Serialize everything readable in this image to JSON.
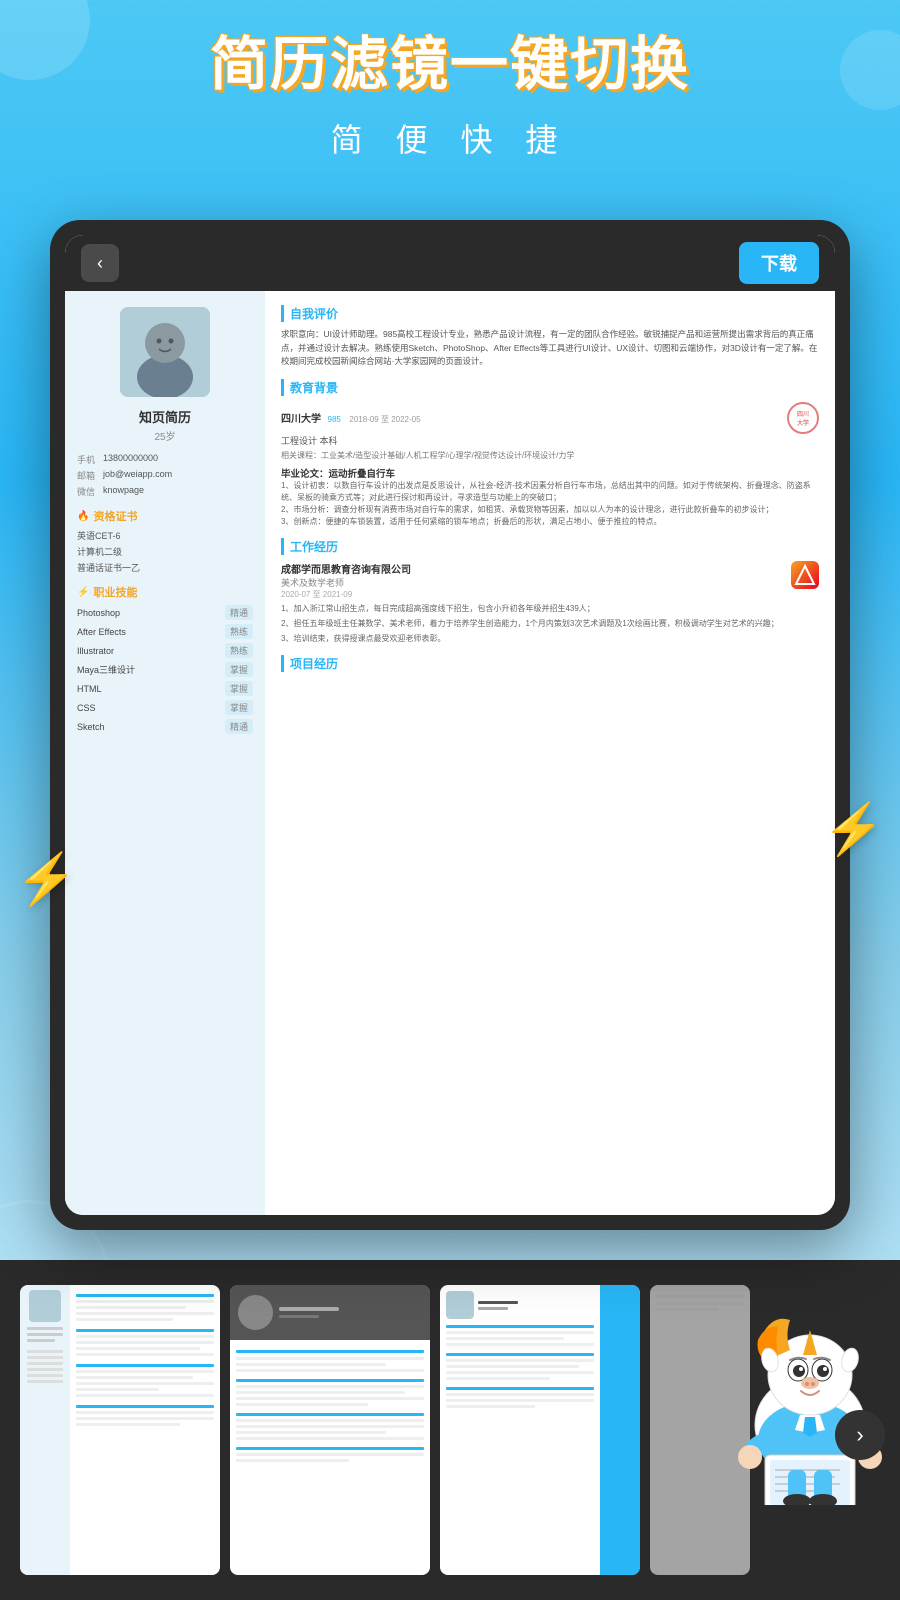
{
  "header": {
    "main_title": "简历滤镜一键切换",
    "sub_title": "简 便 快 捷"
  },
  "nav": {
    "back_label": "‹",
    "download_label": "下载"
  },
  "resume": {
    "name": "知页简历",
    "age": "25岁",
    "contacts": [
      {
        "label": "手机",
        "value": "13800000000"
      },
      {
        "label": "邮箱",
        "value": "job@weiapp.com"
      },
      {
        "label": "微信",
        "value": "knowpage"
      }
    ],
    "certs_title": "资格证书",
    "certs": [
      "英语CET-6",
      "计算机二级",
      "普通话证书一乙"
    ],
    "skills_title": "职业技能",
    "skills": [
      {
        "name": "Photoshop",
        "level": "精通"
      },
      {
        "name": "After Effects",
        "level": "熟练"
      },
      {
        "name": "Illustrator",
        "level": "熟练"
      },
      {
        "name": "Maya三维设计",
        "level": "掌握"
      },
      {
        "name": "HTML",
        "level": "掌握"
      },
      {
        "name": "CSS",
        "level": "掌握"
      },
      {
        "name": "Sketch",
        "level": "精通"
      }
    ],
    "self_eval_title": "自我评价",
    "self_eval": "求职意向：UI设计师助理。985高校工程设计专业，熟悉产品设计流程，有一定的团队合作经验。敏锐捕捉产品和运营所提出需求背后的真正痛点，并通过设计去解决。熟练使用Sketch、PhotoShop、After Effects等工具进行UI设计、UX设计、切图和云端协作，对3D设计有一定了解。在校期间完成校园新闻综合网站·大学家园网的页面设计。",
    "edu_title": "教育背景",
    "edu_school": "四川大学",
    "edu_level": "985",
    "edu_date": "2018-09 至 2022-05",
    "edu_major": "工程设计 本科",
    "edu_courses": "相关课程：工业美术/造型设计基础/人机工程学/心理学/视觉传达设计/环境设计/力学",
    "edu_project_title": "毕业论文：运动折叠自行车",
    "edu_project_1": "1、设计初衷：以数自行车设计的出发点是反思设计，从社会-经济-技术因素分析自行车市场，总结出其中的问题。如对于传统架构、折叠理念、防盗系统、呆板的骑乘方式等；对此进行探讨和再设计，寻求造型与功能上的突破口；",
    "edu_project_2": "2、市场分析：调查分析现有消费市场对自行车的需求，如租赁、承载货物等因素，加以以人为本的设计理念，进行此款折叠车的初步设计；",
    "edu_project_3": "3、创新点：便捷的车锁装置，适用于任何紧缩的锁车地点；折叠后的形状，满足占地小、便于推拉的特点。",
    "work_title": "工作经历",
    "work_company": "成都学而思教育咨询有限公司",
    "work_role": "美术及数学老师",
    "work_date": "2020-07 至 2021-09",
    "work_desc_1": "1、加入浙江常山招生点，每日完成超高强度线下招生，包含小升初各年级并招生439人；",
    "work_desc_2": "2、担任五年级班主任兼数学、美术老师，着力于培养学生创造能力，1个月内策划3次艺术调题及1次绘画比赛，积极调动学生对艺术的兴趣；",
    "work_desc_3": "3、培训结束，获得授课点最受欢迎老师表彰。",
    "project_title": "项目经历"
  },
  "thumbnails": [
    {
      "id": 1,
      "style": "blue_left"
    },
    {
      "id": 2,
      "style": "gray_top"
    },
    {
      "id": 3,
      "style": "blue_right"
    }
  ],
  "icons": {
    "back": "‹",
    "next": "›",
    "fire": "🔥",
    "lightning": "⚡",
    "star": "★"
  },
  "colors": {
    "primary_blue": "#29b6f6",
    "accent_yellow": "#f5a623",
    "dark_bg": "#2a2a2a",
    "light_blue_bg": "#e8f4fa"
  }
}
